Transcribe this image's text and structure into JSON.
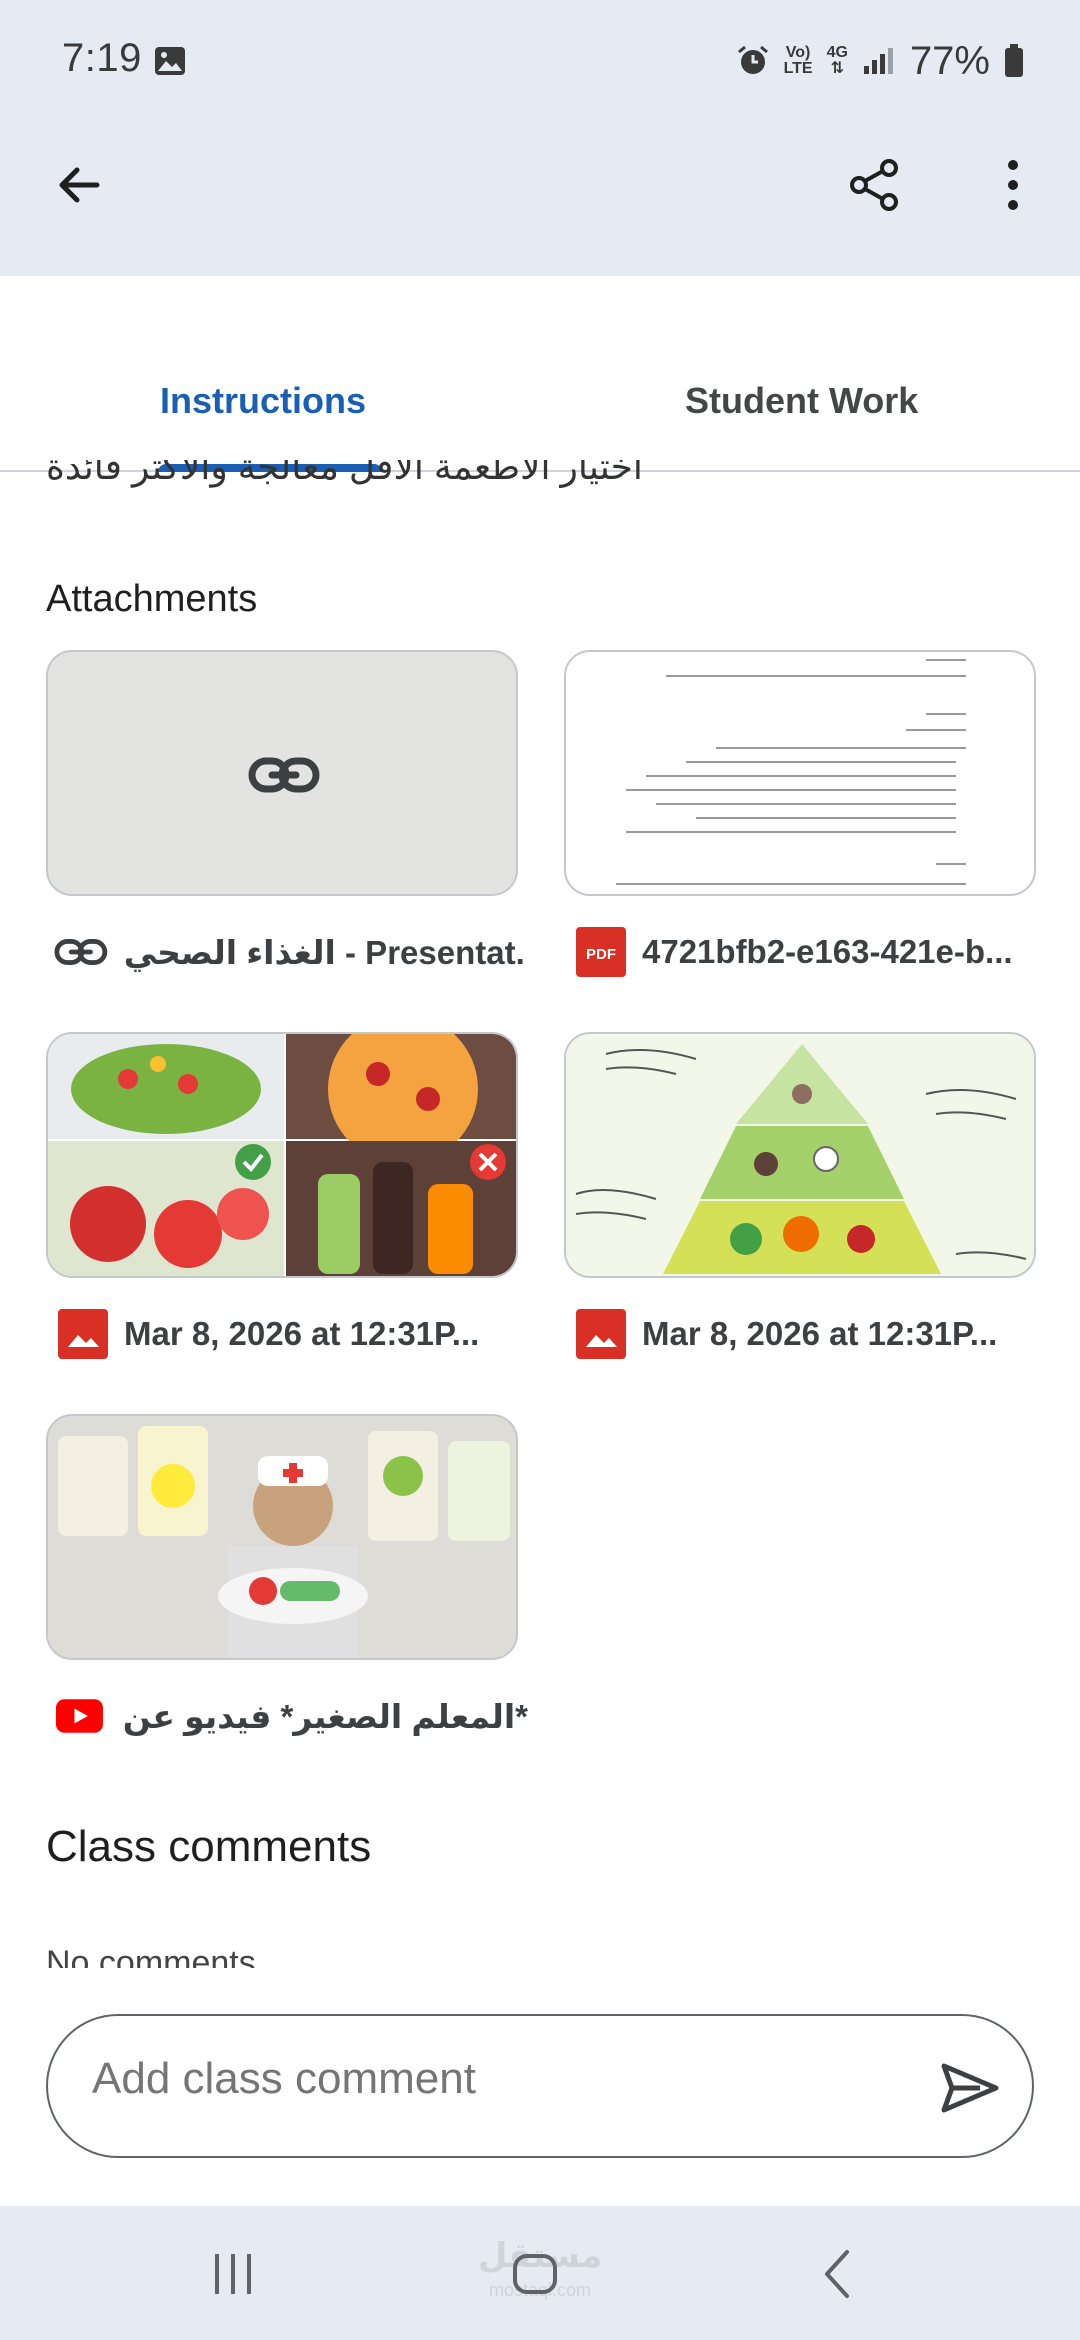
{
  "status_bar": {
    "time": "7:19",
    "network_label_top": "Vo)",
    "network_label_bottom": "LTE",
    "network_type": "4G",
    "battery": "77%"
  },
  "tabs": {
    "instructions": "Instructions",
    "student_work": "Student Work",
    "active": "instructions"
  },
  "description_partial": "اختيار الاطعمة الاقل معالجة والاكثر فائدة",
  "attachments": {
    "title": "Attachments",
    "items": [
      {
        "type": "link",
        "label": "الغذاء الصحي - Presentat..."
      },
      {
        "type": "pdf",
        "label": "4721bfb2-e163-421e-b..."
      },
      {
        "type": "image",
        "label": "Mar 8, 2026 at 12:31P..."
      },
      {
        "type": "image",
        "label": "Mar 8, 2026 at 12:31P..."
      },
      {
        "type": "youtube",
        "label": "*المعلم الصغير* فيديو عن الغ..."
      }
    ]
  },
  "pdf_badge": "PDF",
  "class_comments": {
    "title": "Class comments",
    "peek_text": "No comments",
    "placeholder": "Add class comment"
  },
  "watermark": {
    "main": "مستقل",
    "sub": "mostaql.com"
  },
  "colors": {
    "accent": "#1a5fb4",
    "chrome_bg": "#e6eaf2",
    "youtube_red": "#ff0000",
    "pdf_red": "#d93025"
  }
}
